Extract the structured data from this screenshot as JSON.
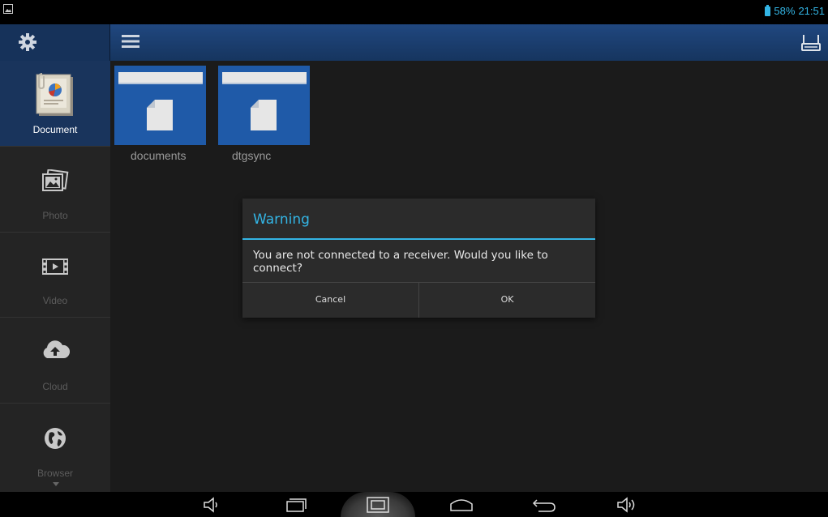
{
  "status_bar": {
    "battery": "58%",
    "time": "21:51"
  },
  "sidebar": {
    "items": [
      {
        "label": "Document",
        "icon": "document-icon",
        "active": true
      },
      {
        "label": "Photo",
        "icon": "photo-icon",
        "active": false
      },
      {
        "label": "Video",
        "icon": "video-icon",
        "active": false
      },
      {
        "label": "Cloud",
        "icon": "cloud-upload-icon",
        "active": false
      },
      {
        "label": "Browser",
        "icon": "globe-icon",
        "active": false
      }
    ]
  },
  "folders": [
    {
      "name": "documents"
    },
    {
      "name": "dtgsync"
    }
  ],
  "dialog": {
    "title": "Warning",
    "message": "You are not connected to a receiver. Would you like to connect?",
    "cancel": "Cancel",
    "ok": "OK"
  },
  "colors": {
    "accent": "#33b5e5",
    "header": "#1f4a85",
    "active": "#19345c",
    "folder": "#1f5aa8"
  }
}
